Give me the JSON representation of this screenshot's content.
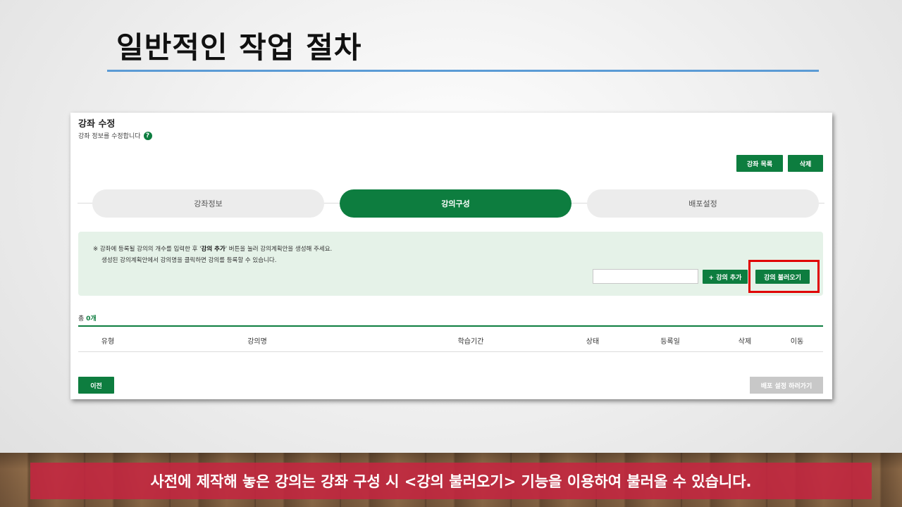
{
  "slide": {
    "title": "일반적인 작업 절차"
  },
  "panel": {
    "title": "강좌 수정",
    "subtitle": "강좌 정보를 수정합니다",
    "help_icon": "?",
    "buttons": {
      "list": "강좌 목록",
      "delete": "삭제"
    },
    "steps": [
      {
        "label": "강좌정보",
        "active": false
      },
      {
        "label": "강의구성",
        "active": true
      },
      {
        "label": "배포설정",
        "active": false
      }
    ],
    "notice": {
      "line1_prefix": "※ 강좌에 등록될 강의의 개수를 입력한 후 '",
      "line1_bold": "강의 추가",
      "line1_suffix": "' 버튼을 눌러 강의계획안을 생성해 주세요.",
      "line2": "생성된 강의계획안에서 강의명을 클릭하면 강의를 등록할 수 있습니다.",
      "input_value": "",
      "add_button": "+ 강의 추가",
      "load_button": "강의 불러오기"
    },
    "total": {
      "label": "총",
      "count": "0개"
    },
    "table": {
      "columns": [
        "유형",
        "강의명",
        "학습기간",
        "상태",
        "등록일",
        "삭제",
        "이동"
      ]
    },
    "footer": {
      "prev": "이전",
      "next": "배포 설정 하러가기"
    }
  },
  "caption": "사전에 제작해 놓은 강의는 강좌 구성 시 <강의 불러오기> 기능을 이용하여 불러올 수 있습니다.",
  "colors": {
    "accent_green": "#0d7d3f",
    "highlight_red": "#e00000",
    "caption_bg": "#c42640",
    "title_rule": "#5b9bd5"
  }
}
